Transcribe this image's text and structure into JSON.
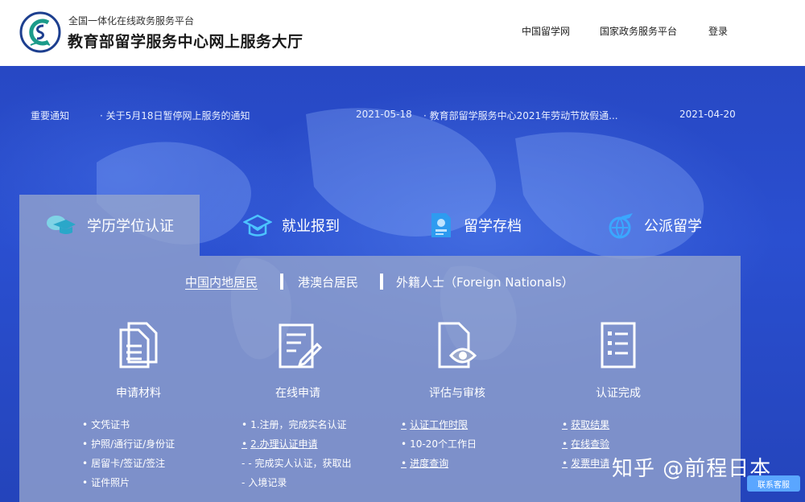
{
  "header": {
    "brand_sub": "全国一体化在线政务服务平台",
    "brand_title": "教育部留学服务中心网上服务大厅",
    "nav": [
      "中国留学网",
      "国家政务服务平台",
      "登录"
    ]
  },
  "notice": {
    "label": "重要通知",
    "items": [
      {
        "title": "· 关于5月18日暂停网上服务的通知",
        "date": "2021-05-18"
      },
      {
        "title": "· 教育部留学服务中心2021年劳动节放假通...",
        "date": "2021-04-20"
      }
    ]
  },
  "tabs": [
    "学历学位认证",
    "就业报到",
    "留学存档",
    "公派留学"
  ],
  "residency": [
    "中国内地居民",
    "港澳台居民",
    "外籍人士（Foreign Nationals）"
  ],
  "steps": [
    {
      "label": "申请材料",
      "items": [
        "文凭证书",
        "护照/通行证/身份证",
        "居留卡/签证/签注",
        "证件照片"
      ]
    },
    {
      "label": "在线申请",
      "items": [
        "1.注册，完成实名认证",
        "2.办理认证申请",
        "- 完成实人认证，获取出",
        "入境记录"
      ]
    },
    {
      "label": "评估与审核",
      "items": [
        "认证工作时限",
        "10-20个工作日",
        "进度查询"
      ]
    },
    {
      "label": "认证完成",
      "items": [
        "获取结果",
        "在线查验",
        "发票申请"
      ]
    }
  ],
  "watermark": "知乎 @前程日本",
  "service_button": "联系客服",
  "colors": {
    "accent": "#2a4fd0",
    "logo_teal": "#1b9b8a",
    "logo_blue": "#1d3f8f"
  }
}
